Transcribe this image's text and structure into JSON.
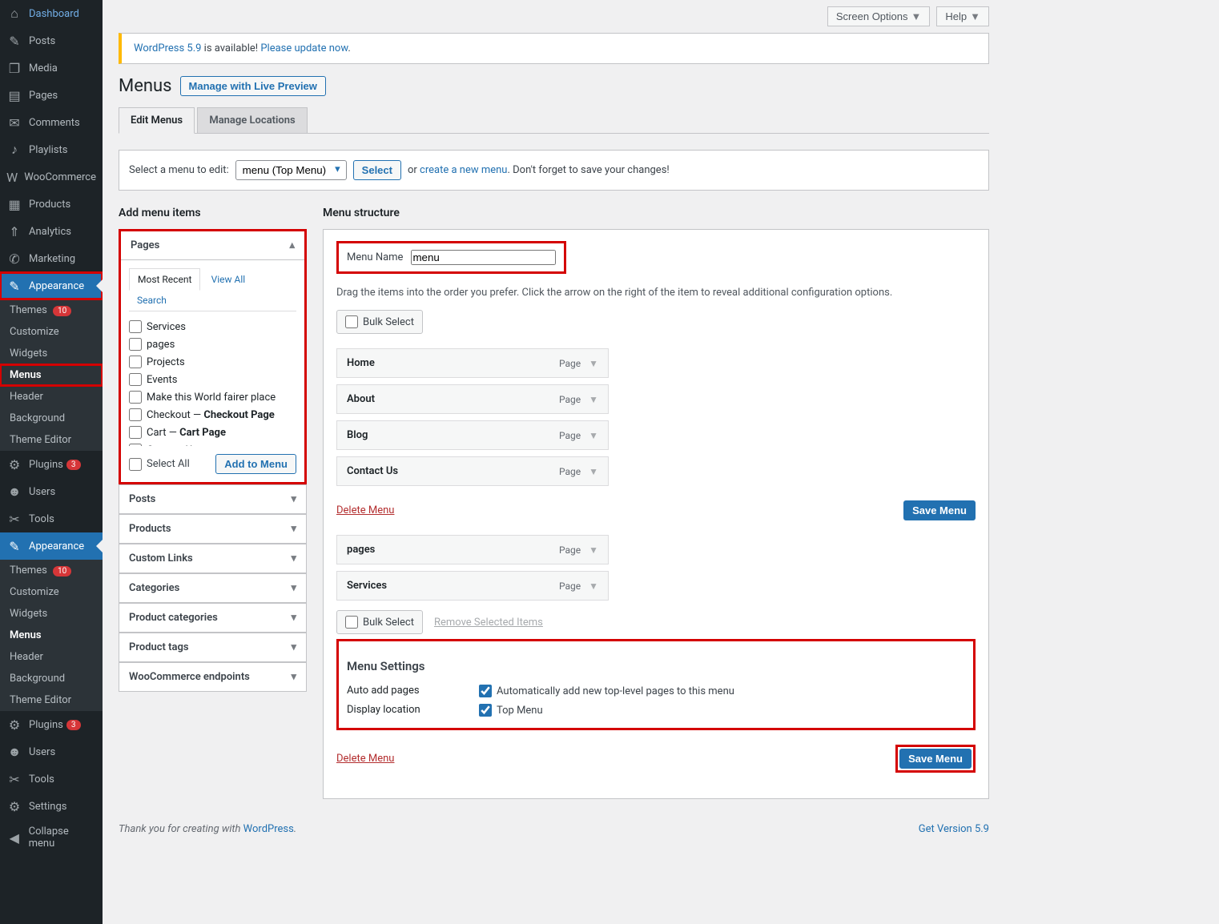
{
  "topbar": {
    "screen_options": "Screen Options",
    "help": "Help"
  },
  "notice": {
    "pre": "WordPress 5.9",
    "mid": " is available! ",
    "link": "Please update now",
    "post": "."
  },
  "title": "Menus",
  "live_preview": "Manage with Live Preview",
  "tabs": {
    "edit": "Edit Menus",
    "loc": "Manage Locations"
  },
  "selbar": {
    "label": "Select a menu to edit:",
    "option": "menu (Top Menu)",
    "select": "Select",
    "or": "or",
    "create": "create a new menu",
    "tail": ". Don't forget to save your changes!"
  },
  "lcol": {
    "h": "Add menu items",
    "pages": "Pages",
    "inn": {
      "recent": "Most Recent",
      "all": "View All",
      "search": "Search"
    },
    "list": [
      "Services",
      "pages",
      "Projects",
      "Events",
      "Make this World fairer place"
    ],
    "list_html": [
      {
        "a": "Checkout — ",
        "b": "Checkout Page"
      },
      {
        "a": "Cart — ",
        "b": "Cart Page"
      }
    ],
    "list2": [
      "Contact Us"
    ],
    "select_all": "Select All",
    "add": "Add to Menu",
    "accs": [
      "Posts",
      "Products",
      "Custom Links",
      "Categories",
      "Product categories",
      "Product tags",
      "WooCommerce endpoints"
    ]
  },
  "rcol": {
    "h": "Menu structure",
    "name_lbl": "Menu Name",
    "name_val": "menu",
    "hint": "Drag the items into the order you prefer. Click the arrow on the right of the item to reveal additional configuration options.",
    "bulk": "Bulk Select",
    "items": [
      "Home",
      "About",
      "Blog",
      "Contact Us"
    ],
    "type": "Page",
    "del": "Delete Menu",
    "save": "Save Menu",
    "items2": [
      "pages",
      "Services"
    ],
    "remove": "Remove Selected Items",
    "settings": {
      "h": "Menu Settings",
      "auto_lbl": "Auto add pages",
      "auto_txt": "Automatically add new top-level pages to this menu",
      "disp_lbl": "Display location",
      "disp_txt": "Top Menu"
    }
  },
  "sidebar": {
    "items": [
      {
        "ico": "⌂",
        "l": "Dashboard"
      },
      {
        "ico": "✎",
        "l": "Posts"
      },
      {
        "ico": "❐",
        "l": "Media"
      },
      {
        "ico": "▤",
        "l": "Pages"
      },
      {
        "ico": "✉",
        "l": "Comments"
      },
      {
        "ico": "♪",
        "l": "Playlists"
      },
      {
        "ico": "W",
        "l": "WooCommerce"
      },
      {
        "ico": "▦",
        "l": "Products"
      },
      {
        "ico": "⇑",
        "l": "Analytics"
      },
      {
        "ico": "✆",
        "l": "Marketing"
      }
    ],
    "appearance": {
      "ico": "✐",
      "l": "Appearance"
    },
    "subs": [
      "Themes",
      "Customize",
      "Widgets",
      "Menus",
      "Header",
      "Background",
      "Theme Editor"
    ],
    "themes_badge": "10",
    "items2": [
      {
        "ico": "⚙",
        "l": "Plugins",
        "b": "3"
      },
      {
        "ico": "☻",
        "l": "Users"
      },
      {
        "ico": "✂",
        "l": "Tools"
      }
    ],
    "items3": [
      {
        "ico": "⚙",
        "l": "Plugins",
        "b": "3"
      },
      {
        "ico": "☻",
        "l": "Users"
      },
      {
        "ico": "✂",
        "l": "Tools"
      },
      {
        "ico": "⚙",
        "l": "Settings"
      }
    ],
    "collapse": {
      "ico": "◀",
      "l": "Collapse menu"
    }
  },
  "footer": {
    "pre": "Thank you for creating with ",
    "wp": "WordPress",
    "post": ".",
    "ver": "Get Version 5.9"
  }
}
